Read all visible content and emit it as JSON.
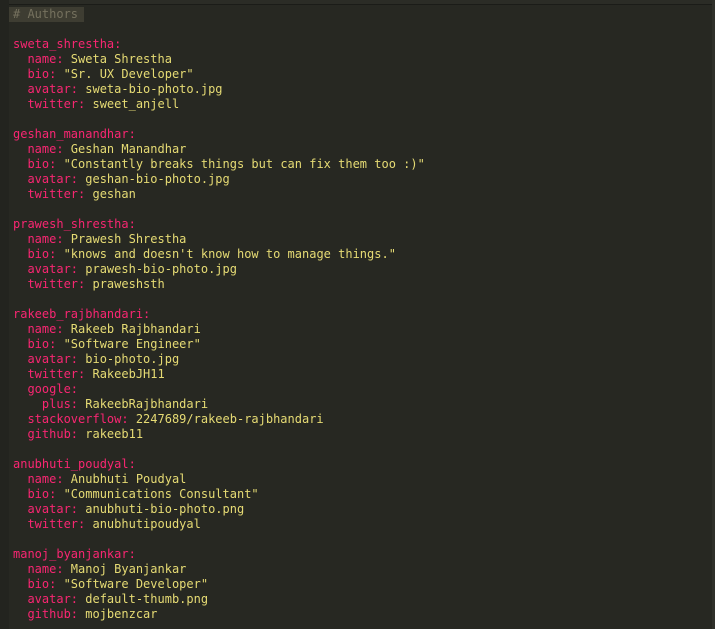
{
  "editor": {
    "comment": "# Authors",
    "authors": [
      {
        "key": "sweta_shrestha:",
        "fields": [
          {
            "k": "  name:",
            "v": " Sweta Shrestha"
          },
          {
            "k": "  bio:",
            "v": " \"Sr. UX Developer\""
          },
          {
            "k": "  avatar:",
            "v": " sweta-bio-photo.jpg"
          },
          {
            "k": "  twitter:",
            "v": " sweet_anjell"
          }
        ]
      },
      {
        "key": "geshan_manandhar:",
        "fields": [
          {
            "k": "  name:",
            "v": " Geshan Manandhar"
          },
          {
            "k": "  bio:",
            "v": " \"Constantly breaks things but can fix them too :)\""
          },
          {
            "k": "  avatar:",
            "v": " geshan-bio-photo.jpg"
          },
          {
            "k": "  twitter:",
            "v": " geshan"
          }
        ]
      },
      {
        "key": "prawesh_shrestha:",
        "fields": [
          {
            "k": "  name:",
            "v": " Prawesh Shrestha"
          },
          {
            "k": "  bio:",
            "v": " \"knows and doesn't know how to manage things.\""
          },
          {
            "k": "  avatar:",
            "v": " prawesh-bio-photo.jpg"
          },
          {
            "k": "  twitter:",
            "v": " praweshsth"
          }
        ]
      },
      {
        "key": "rakeeb_rajbhandari:",
        "fields": [
          {
            "k": "  name:",
            "v": " Rakeeb Rajbhandari"
          },
          {
            "k": "  bio:",
            "v": " \"Software Engineer\""
          },
          {
            "k": "  avatar:",
            "v": " bio-photo.jpg"
          },
          {
            "k": "  twitter:",
            "v": " RakeebJH11"
          },
          {
            "k": "  google:",
            "v": ""
          },
          {
            "k": "    plus:",
            "v": " RakeebRajbhandari"
          },
          {
            "k": "  stackoverflow:",
            "v": " 2247689/rakeeb-rajbhandari"
          },
          {
            "k": "  github:",
            "v": " rakeeb11"
          }
        ]
      },
      {
        "key": "anubhuti_poudyal:",
        "fields": [
          {
            "k": "  name:",
            "v": " Anubhuti Poudyal"
          },
          {
            "k": "  bio:",
            "v": " \"Communications Consultant\""
          },
          {
            "k": "  avatar:",
            "v": " anubhuti-bio-photo.png"
          },
          {
            "k": "  twitter:",
            "v": " anubhutipoudyal"
          }
        ]
      },
      {
        "key": "manoj_byanjankar:",
        "fields": [
          {
            "k": "  name:",
            "v": " Manoj Byanjankar"
          },
          {
            "k": "  bio:",
            "v": " \"Software Developer\""
          },
          {
            "k": "  avatar:",
            "v": " default-thumb.png"
          },
          {
            "k": "  github:",
            "v": " mojbenzcar"
          }
        ]
      }
    ]
  }
}
